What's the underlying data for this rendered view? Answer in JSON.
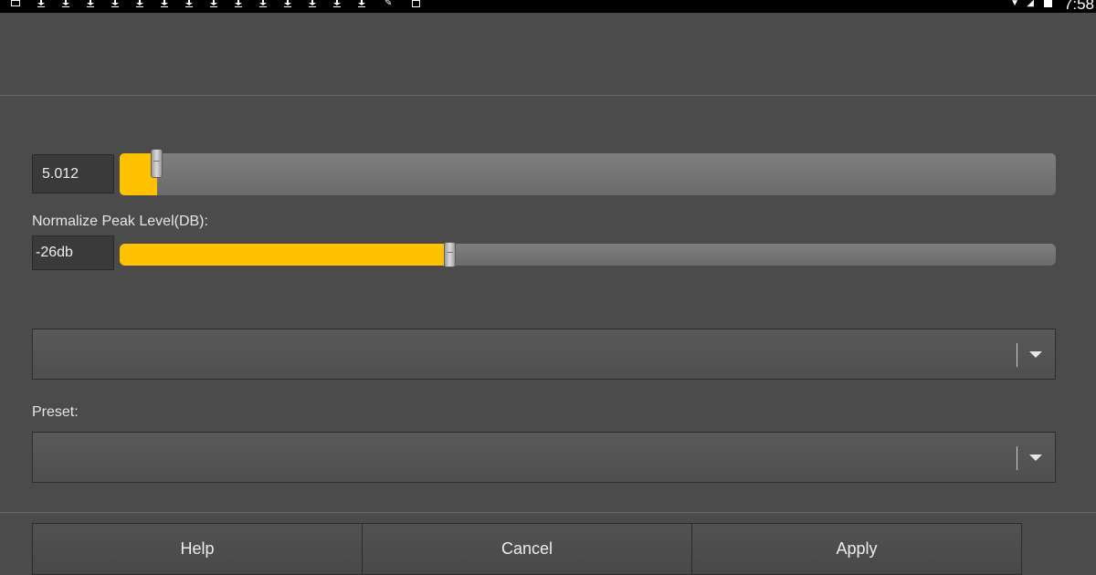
{
  "status_bar": {
    "time": "7:58",
    "icons": [
      "image-icon",
      "download-icon",
      "download-icon",
      "download-icon",
      "download-icon",
      "download-icon",
      "download-icon",
      "download-icon",
      "download-icon",
      "download-icon",
      "download-icon",
      "download-icon",
      "download-icon",
      "download-icon",
      "download-icon",
      "download-icon",
      "edit-icon",
      "file-icon",
      "wifi-icon",
      "signal-icon",
      "battery-icon"
    ]
  },
  "amplify": {
    "value": "5.012",
    "level": 0.04
  },
  "normalize": {
    "label": "Normalize Peak Level(DB):",
    "value": "-26db",
    "level": 0.353
  },
  "dropdown_1": {
    "selected": ""
  },
  "preset": {
    "label": "Preset:",
    "selected": ""
  },
  "buttons": {
    "help": "Help",
    "cancel": "Cancel",
    "apply": "Apply"
  },
  "colors": {
    "accent": "#ffc200",
    "background": "#4b4b4b"
  }
}
